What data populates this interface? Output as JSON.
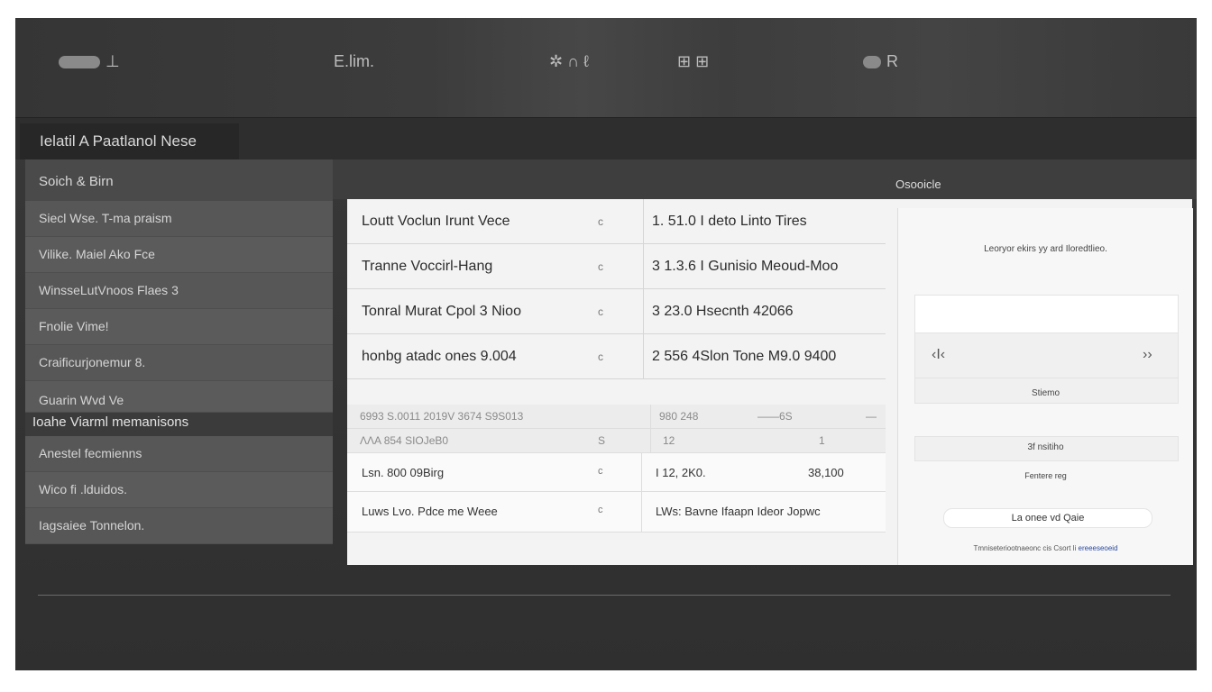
{
  "topbar": {
    "items": [
      {
        "icon": "toggle-icon",
        "label": "⊥"
      },
      {
        "icon": "logo-icon",
        "label": "E.lim."
      },
      {
        "icon": "settings-cluster-icon",
        "label": "✲ ∩ ℓ"
      },
      {
        "icon": "grid-icon",
        "label": "⊞ ⊞"
      },
      {
        "icon": "account-icon",
        "label": "R"
      }
    ]
  },
  "title": "Ielatil A Paatlanol Nese",
  "sidebar": {
    "header": "Soich & Birn",
    "items": [
      "Siecl Wse. T-ma praism",
      "Vilike. Maiel Ako Fce",
      "WinsseLutVnoos Flaes 3",
      "Fnolie Vime!",
      "Craificurjonemur 8.",
      "Guarin Wvd Ve"
    ],
    "group_label": "Ioahe Viarml memanisons",
    "group_items": [
      "Anestel fecmienns",
      "Wico fi .lduidos.",
      "Iagsaiee Tonnelon."
    ]
  },
  "main": {
    "header_label": "Osooicle"
  },
  "table": {
    "rows": [
      {
        "name": "Loutt Voclun Irunt Vece",
        "marker": "c",
        "value": "1. 51.0 I deto Linto Tires"
      },
      {
        "name": "Tranne Voccirl-Hang",
        "marker": "c",
        "value": "3 1.3.6 I Gunisio Meoud-Moo"
      },
      {
        "name": "Tonral Murat Cpol 3 Nioo",
        "marker": "c",
        "value": "3 23.0 Hsecnth 42066"
      },
      {
        "name": "honbg atadc ones 9.004",
        "marker": "c",
        "value": "2 556 4Slon Tone M9.0 9400"
      }
    ]
  },
  "subtable": {
    "head1": [
      "6993 S.0011 2019V 3674 S9S013",
      "980 248",
      "——6S",
      "—"
    ],
    "head2": [
      "ΛΛA 854 SIOJeB0",
      "S",
      "12",
      "1"
    ],
    "rows": [
      {
        "name": "Lsn. 800 09Birg",
        "marker": "c",
        "value": "I 12, 2K0.",
        "extra": "38,100"
      },
      {
        "name": "Luws Lvo. Pdce me Weee",
        "marker": "c",
        "value": "LWs: Bavne Ifaapn Ideor Jopwc",
        "extra": ""
      }
    ]
  },
  "right_panel": {
    "intro": "Leoryor ekirs yy ard Iloredtlieo.",
    "nav_prev": "‹I‹",
    "nav_next": "››",
    "caption1": "Stiemo",
    "caption2": "3f nsitiho",
    "caption3": "Fentere reg",
    "pill": "La onee vd Qaie",
    "footer_text": "Tmniseteriootnaeonc cis Csort li ",
    "footer_link": "ereeeseoeid"
  }
}
